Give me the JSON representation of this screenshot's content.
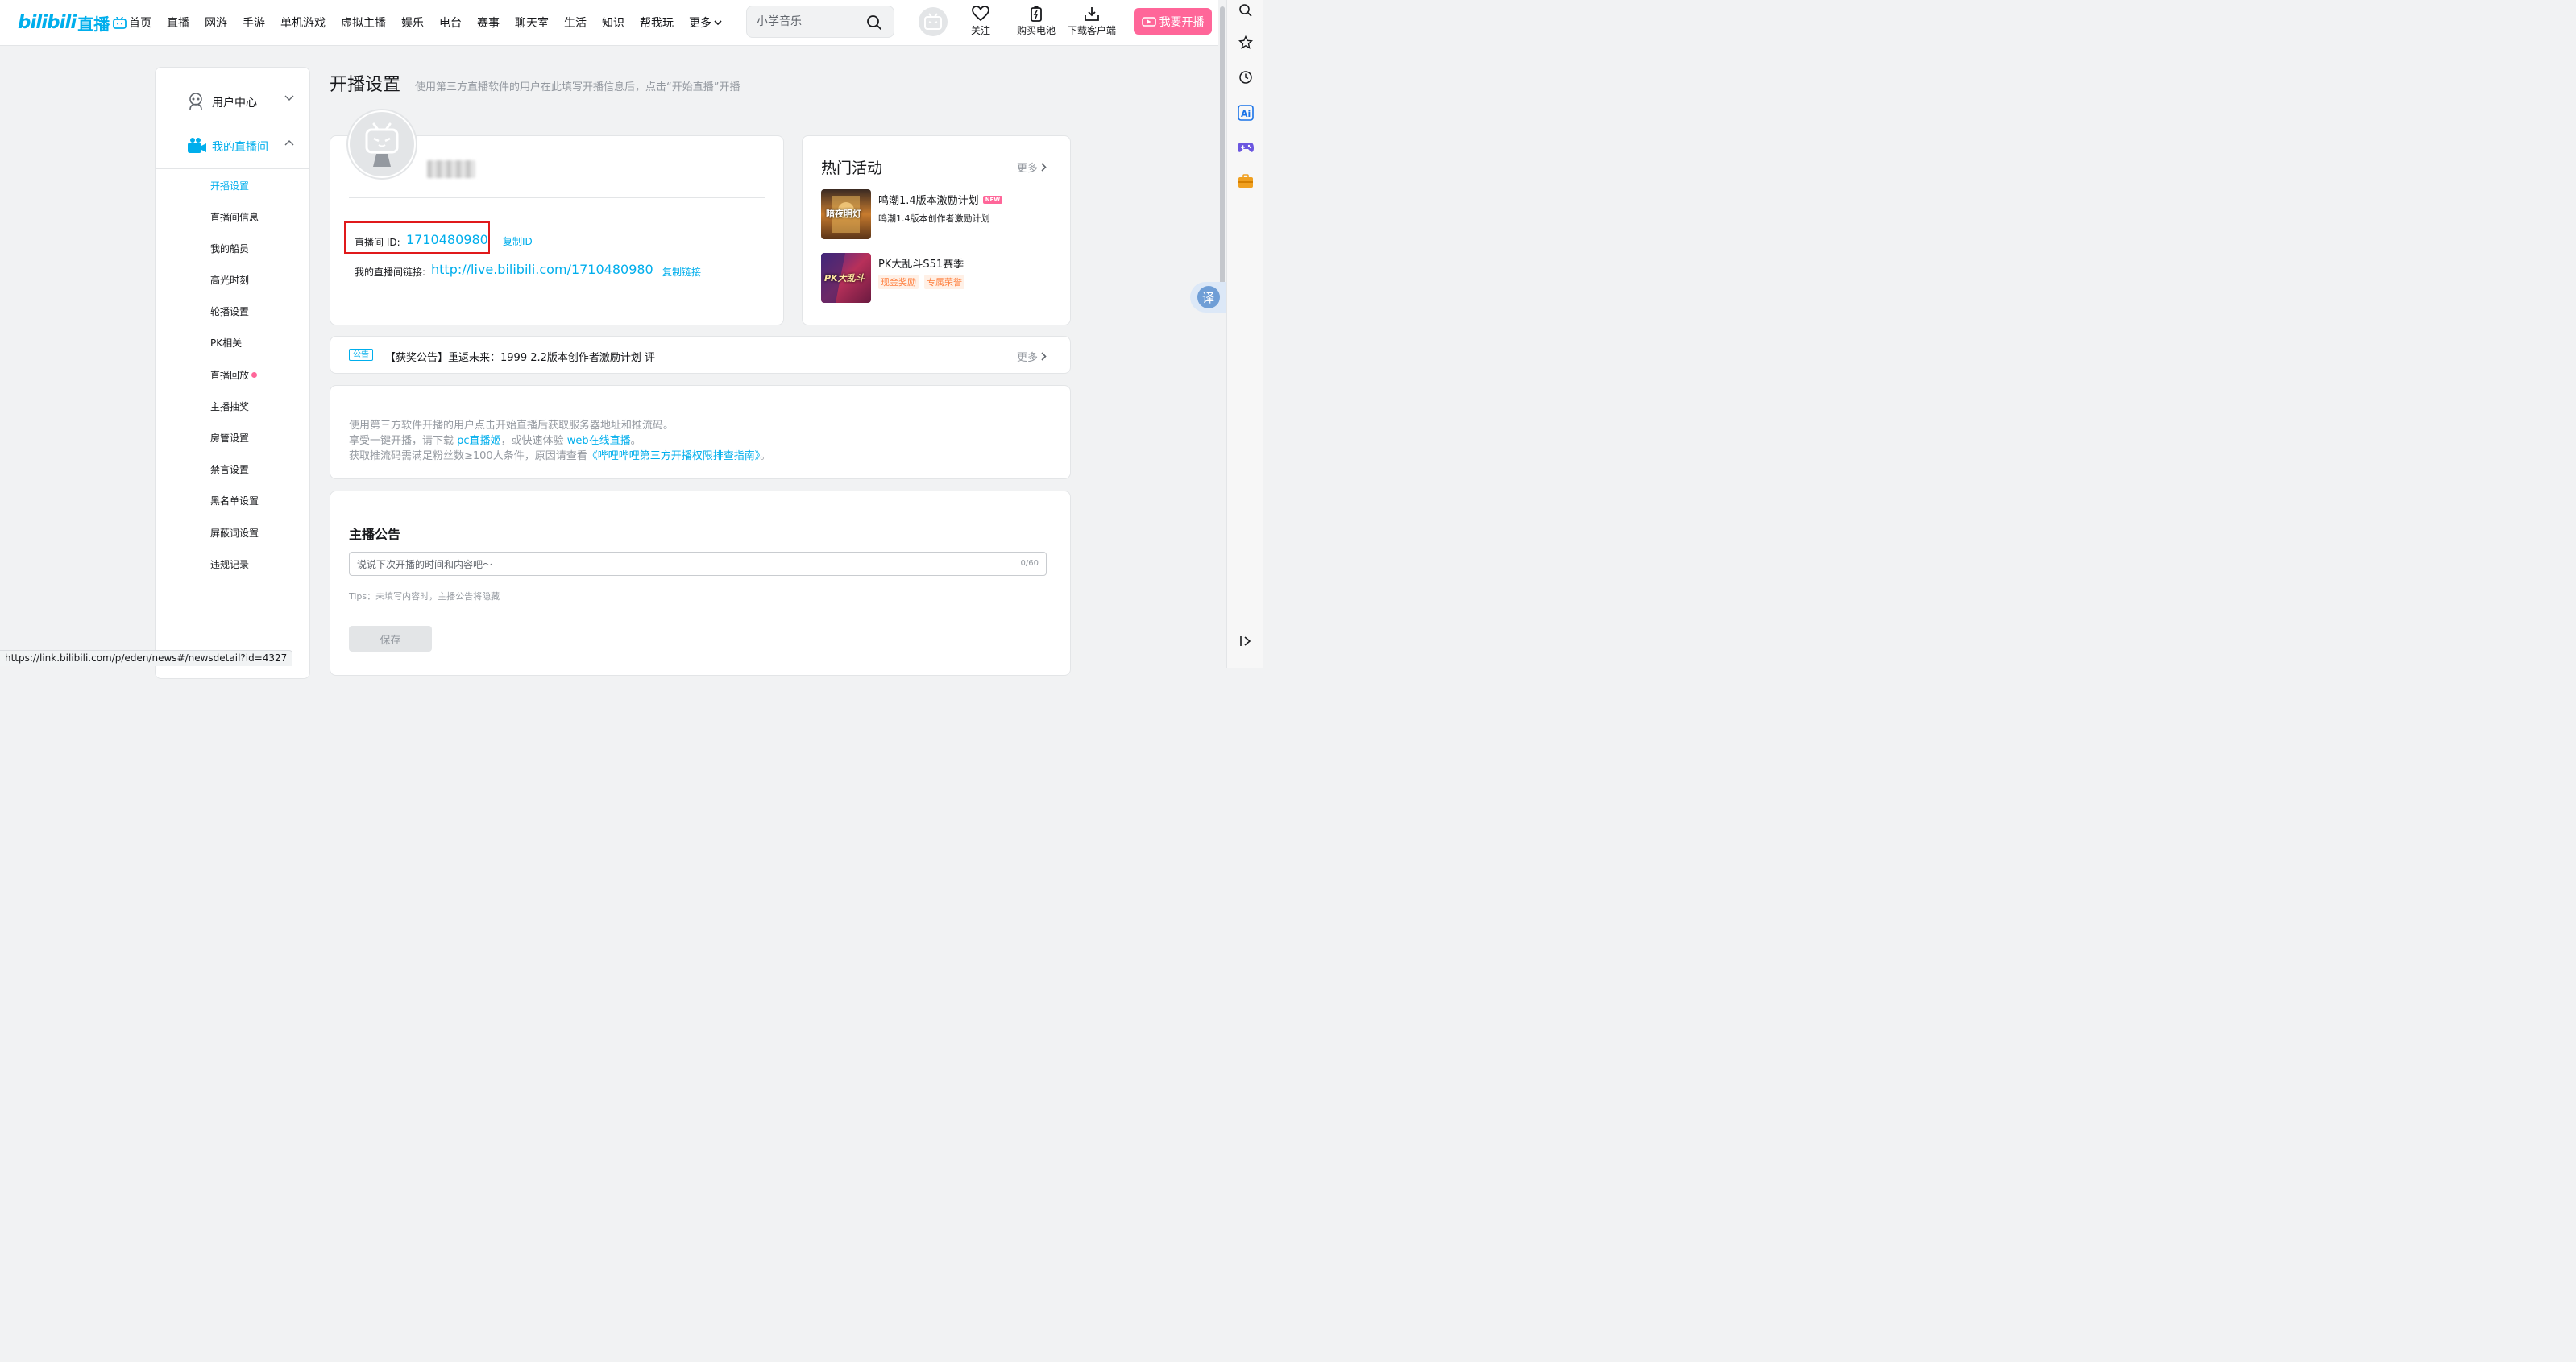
{
  "logo": {
    "en": "bilibili",
    "cn": "直播"
  },
  "nav": {
    "items": [
      "首页",
      "直播",
      "网游",
      "手游",
      "单机游戏",
      "虚拟主播",
      "娱乐",
      "电台",
      "赛事",
      "聊天室",
      "生活",
      "知识",
      "帮我玩",
      "更多"
    ]
  },
  "search": {
    "placeholder": "小学音乐"
  },
  "top_actions": {
    "follow": "关注",
    "battery": "购买电池",
    "download": "下载客户端",
    "start_live": "我要开播"
  },
  "sidebar": {
    "user_center": "用户中心",
    "my_room": "我的直播间",
    "items": [
      "开播设置",
      "直播间信息",
      "我的船员",
      "高光时刻",
      "轮播设置",
      "PK相关",
      "直播回放",
      "主播抽奖",
      "房管设置",
      "禁言设置",
      "黑名单设置",
      "屏蔽词设置",
      "违规记录"
    ]
  },
  "page": {
    "title": "开播设置",
    "subtitle": "使用第三方直播软件的用户在此填写开播信息后，点击“开始直播”开播"
  },
  "profile": {
    "room_id_label": "直播间 ID:",
    "room_id": "1710480980",
    "copy_id": "复制ID",
    "room_link_label": "我的直播间链接:",
    "room_link": "http://live.bilibili.com/1710480980",
    "copy_link": "复制链接"
  },
  "events": {
    "title": "热门活动",
    "more": "更多",
    "items": [
      {
        "title": "鸣潮1.4版本激励计划",
        "badge": "NEW",
        "desc": "鸣潮1.4版本创作者激励计划",
        "thumb_text": "暗夜明灯"
      },
      {
        "title": "PK大乱斗S51赛季",
        "tags": [
          "现金奖励",
          "专属荣誉"
        ],
        "thumb_text": "PK大乱斗"
      }
    ]
  },
  "notice": {
    "tag": "公告",
    "text": "【获奖公告】重返未来：1999 2.2版本创作者激励计划 评",
    "more": "更多"
  },
  "info": {
    "line1": "使用第三方软件开播的用户点击开始直播后获取服务器地址和推流码。",
    "line2_prefix": "享受一键开播，请下载 ",
    "line2_link1": "pc直播姬",
    "line2_mid": "，或快速体验 ",
    "line2_link2": "web在线直播",
    "line2_suffix": "。",
    "line3_prefix": "获取推流码需满足粉丝数≥100人条件，原因请查看",
    "line3_link": "《哔哩哔哩第三方开播权限排查指南》",
    "line3_suffix": "。"
  },
  "announcement": {
    "title": "主播公告",
    "placeholder": "说说下次开播的时间和内容吧～",
    "count": "0/60",
    "tips": "Tips：未填写内容时，主播公告将隐藏",
    "save": "保存"
  },
  "status_bar": {
    "url": "https://link.bilibili.com/p/eden/news#/newsdetail?id=4327"
  },
  "translate": {
    "label": "译"
  },
  "colors": {
    "accent": "#00aeec",
    "pink": "#ff6699",
    "highlight_border": "#e0191b"
  }
}
